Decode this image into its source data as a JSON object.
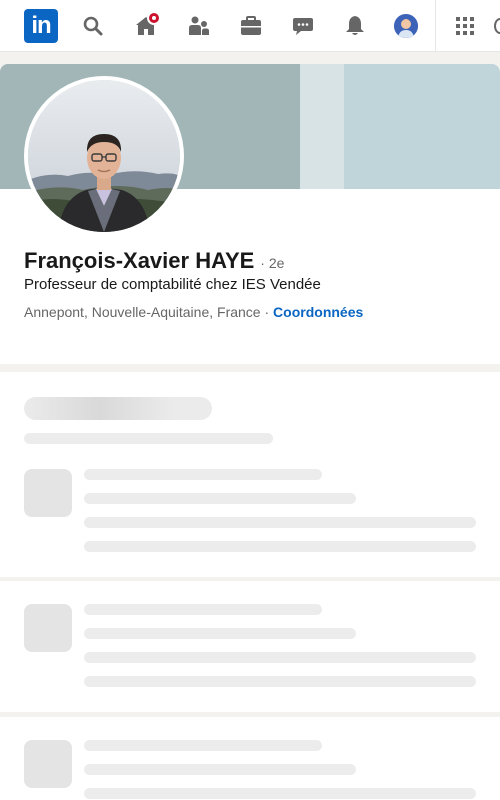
{
  "nav": {
    "logo_text": "in",
    "icons": [
      "search-icon",
      "home-icon",
      "my-network-icon",
      "jobs-icon",
      "messaging-icon",
      "notifications-icon",
      "me-avatar",
      "apps-grid-icon"
    ],
    "notification_color": "#cb112d"
  },
  "profile": {
    "name": "François-Xavier HAYE",
    "degree": "· 2e",
    "headline": "Professeur de comptabilité chez IES Vendée",
    "location": "Annepont, Nouvelle-Aquitaine, France",
    "separator": "·",
    "contact_link": "Coordonnées"
  },
  "colors": {
    "brand": "#0a66c2",
    "banner_light": "#c0d5da",
    "banner_dark": "#a2b6b8",
    "page_bg": "#f4f2ee"
  }
}
